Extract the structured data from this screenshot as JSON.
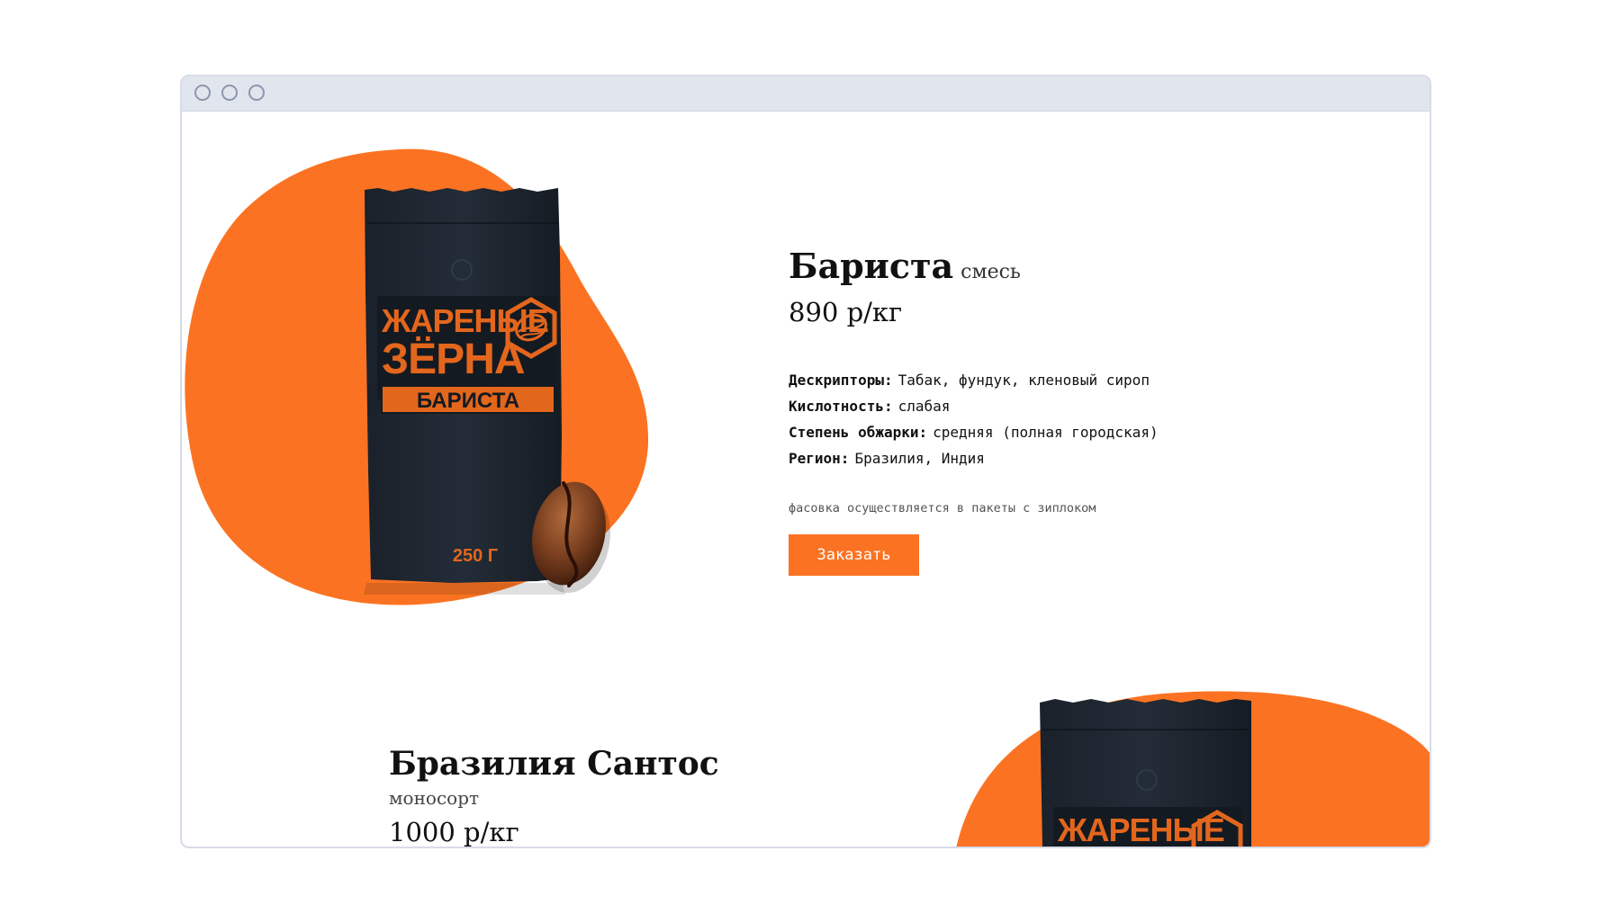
{
  "colors": {
    "accent": "#fb7322",
    "bag": "#1e2630",
    "bag_label": "#e3661d",
    "frame": "#e0e5ee"
  },
  "window": {
    "controls": [
      "window-dot-icon",
      "window-dot-icon",
      "window-dot-icon"
    ]
  },
  "product": {
    "bag_brand_line1": "ЖАРЕНЫЕ",
    "bag_brand_line2": "ЗЁРНА",
    "bag_name": "БАРИСТА",
    "bag_weight": "250 Г",
    "name": "Бариста",
    "type": "смесь",
    "price": "890 р/кг",
    "specs": [
      {
        "key": "Дескрипторы:",
        "value": "Табак, фундук, кленовый сироп"
      },
      {
        "key": "Кислотность:",
        "value": "слабая"
      },
      {
        "key": "Степень обжарки:",
        "value": "средняя (полная городская)"
      },
      {
        "key": "Регион:",
        "value": "Бразилия, Индия"
      }
    ],
    "packing_note": "фасовка осуществляется в пакеты с зиплоком",
    "order_label": "Заказать"
  },
  "product2": {
    "name": "Бразилия Сантос",
    "type": "моносорт",
    "price": "1000 р/кг",
    "bag_brand_line1": "ЖАРЕНЫЕ"
  }
}
